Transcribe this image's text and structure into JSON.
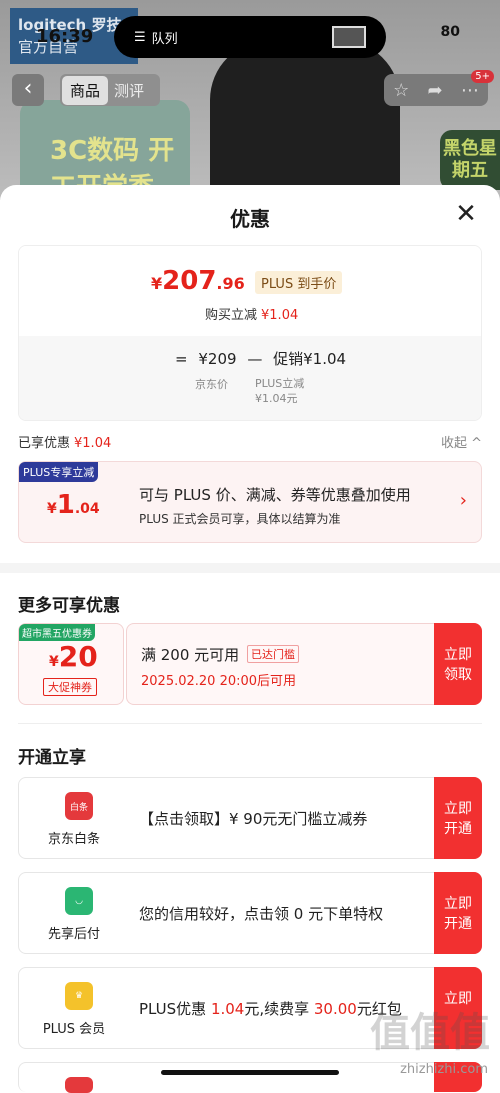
{
  "status": {
    "time": "16:39",
    "battery": "80"
  },
  "queue": {
    "label": "队列"
  },
  "background": {
    "logo_line1": "logitech 罗技",
    "logo_line2": "官方自营",
    "promo": "3C数码 开工开学季",
    "badge": "黑色星期五",
    "cart_count": "5+"
  },
  "nav": {
    "tab_product": "商品",
    "tab_review": "测评"
  },
  "sheet": {
    "title": "优惠"
  },
  "price": {
    "yen": "¥",
    "int": "207",
    "dec": ".96",
    "plus_tag": "PLUS 到手价",
    "buy_reduce_label": "购买立减",
    "buy_reduce_value": "¥1.04",
    "eq": "=",
    "jd_price": "¥209",
    "minus": "—",
    "promo": "促销¥1.04",
    "jd_price_label": "京东价",
    "plus_reduce_label": "PLUS立减",
    "plus_reduce_value": "¥1.04元"
  },
  "enjoyed": {
    "label": "已享优惠",
    "value": "¥1.04",
    "collapse": "收起 ^"
  },
  "plus_offer": {
    "tag": "PLUS专享立减",
    "yen": "¥",
    "int": "1",
    "dec": ".04",
    "text1": "可与 PLUS 价、满减、券等优惠叠加使用",
    "text2": "PLUS 正式会员可享，具体以结算为准",
    "arrow": "›"
  },
  "more": {
    "heading": "更多可享优惠",
    "coupon": {
      "tag": "超市黑五优惠券",
      "yen": "¥",
      "amount": "20",
      "sub": "大促神券",
      "title": "满 200 元可用",
      "badge": "已达门槛",
      "time": "2025.02.20 20:00后可用",
      "button": "立即领取"
    }
  },
  "open": {
    "heading": "开通立享",
    "items": [
      {
        "name": "京东白条",
        "icon": "baitiao-icon",
        "icon_text": "白条",
        "text": "【点击领取】¥ 90元无门槛立减券",
        "button": "立即开通",
        "color": "#e4393c"
      },
      {
        "name": "先享后付",
        "icon": "bag-icon",
        "icon_text": "",
        "text": "您的信用较好，点击领 0 元下单特权",
        "button": "立即开通",
        "color": "#2bb673"
      },
      {
        "name": "PLUS 会员",
        "icon": "crown-icon",
        "icon_text": "",
        "text_a": "PLUS优惠 ",
        "text_b": "1.04",
        "text_c": "元,续费享 ",
        "text_d": "30.00",
        "text_e": "元红包",
        "button": "立即",
        "color": "#f4c22b"
      }
    ]
  },
  "watermark": {
    "big": "值值值",
    "small": "zhizhizhi.com"
  }
}
